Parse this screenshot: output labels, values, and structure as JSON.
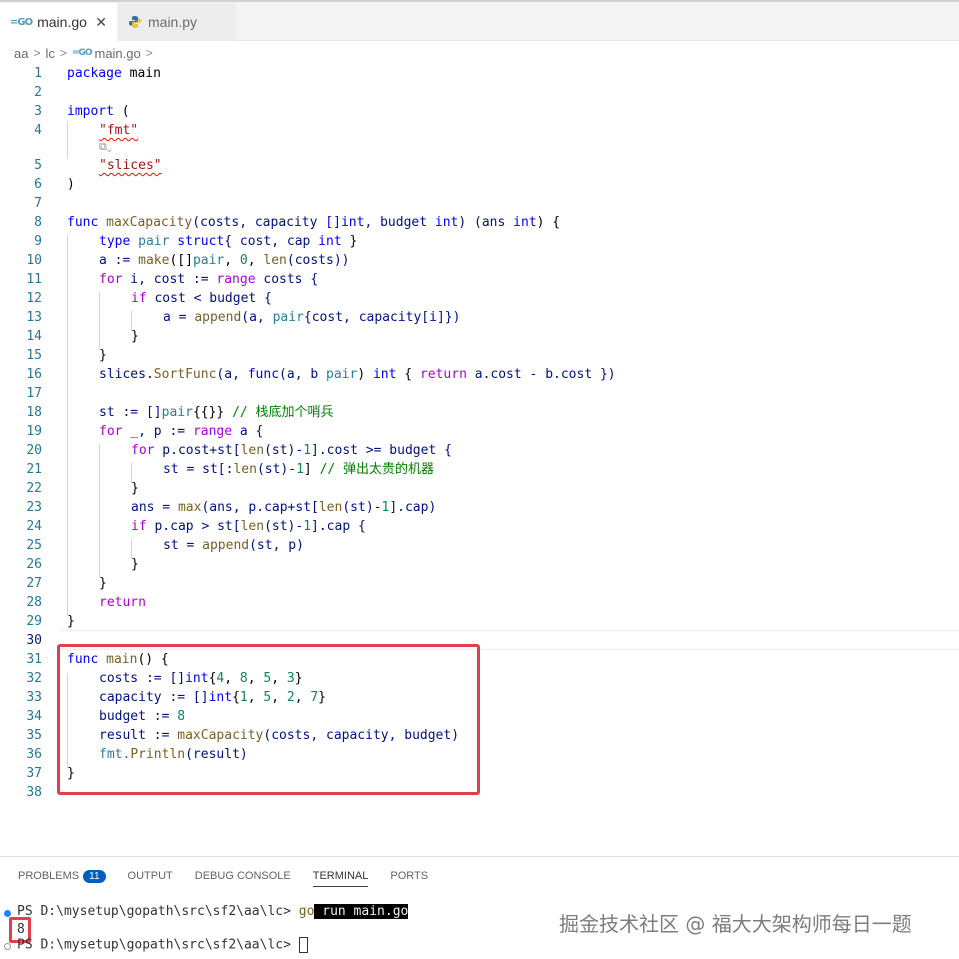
{
  "tabs": [
    {
      "label": "main.go",
      "icon": "go-file-icon",
      "active": true
    },
    {
      "label": "main.py",
      "icon": "python-file-icon",
      "active": false
    }
  ],
  "breadcrumb": [
    "aa",
    "lc",
    "main.go",
    ""
  ],
  "code_lines": [
    {
      "n": "1"
    },
    {
      "n": "2"
    },
    {
      "n": "3"
    },
    {
      "n": "4"
    },
    {
      "n": "5"
    },
    {
      "n": "6"
    },
    {
      "n": "7"
    },
    {
      "n": "8"
    },
    {
      "n": "9"
    },
    {
      "n": "10"
    },
    {
      "n": "11"
    },
    {
      "n": "12"
    },
    {
      "n": "13"
    },
    {
      "n": "14"
    },
    {
      "n": "15"
    },
    {
      "n": "16"
    },
    {
      "n": "17"
    },
    {
      "n": "18"
    },
    {
      "n": "19"
    },
    {
      "n": "20"
    },
    {
      "n": "21"
    },
    {
      "n": "22"
    },
    {
      "n": "23"
    },
    {
      "n": "24"
    },
    {
      "n": "25"
    },
    {
      "n": "26"
    },
    {
      "n": "27"
    },
    {
      "n": "28"
    },
    {
      "n": "29"
    },
    {
      "n": "30"
    },
    {
      "n": "31"
    },
    {
      "n": "32"
    },
    {
      "n": "33"
    },
    {
      "n": "34"
    },
    {
      "n": "35"
    },
    {
      "n": "36"
    },
    {
      "n": "37"
    },
    {
      "n": "38"
    }
  ],
  "code": {
    "l1": [
      "package",
      " main"
    ],
    "l3": [
      "import",
      " ("
    ],
    "l4": "\"fmt\"",
    "l5": "\"slices\"",
    "l6": ")",
    "l8": [
      "func",
      " maxCapacity",
      "(costs, capacity ",
      "[]int",
      ", budget ",
      "int",
      ") (ans ",
      "int",
      ") {"
    ],
    "l9": [
      "type",
      " pair ",
      "struct",
      "{ cost, cap ",
      "int",
      " }"
    ],
    "l10": [
      "a := ",
      "make",
      "([]",
      "pair",
      ", ",
      "0",
      ", ",
      "len",
      "(costs))"
    ],
    "l11": [
      "for",
      " i, cost := ",
      "range",
      " costs {"
    ],
    "l12": [
      "if",
      " cost < budget {"
    ],
    "l13": [
      "a = ",
      "append",
      "(a, ",
      "pair",
      "{cost, capacity[i]})"
    ],
    "l14": "}",
    "l15": "}",
    "l16": [
      "slices.",
      "SortFunc",
      "(a, ",
      "func",
      "(a, b ",
      "pair",
      ") ",
      "int",
      " { ",
      "return",
      " a.cost - b.cost })"
    ],
    "l18": [
      "st := []",
      "pair",
      "{{}} ",
      "// 栈底加个哨兵"
    ],
    "l19": [
      "for",
      " _, p := ",
      "range",
      " a {"
    ],
    "l20": [
      "for",
      " p.cost+st[",
      "len",
      "(st)-",
      "1",
      "].cost >= budget {"
    ],
    "l21": [
      "st = st[:",
      "len",
      "(st)-",
      "1",
      "] ",
      "// 弹出太贵的机器"
    ],
    "l22": "}",
    "l23": [
      "ans = ",
      "max",
      "(ans, p.cap+st[",
      "len",
      "(st)-",
      "1",
      "].cap)"
    ],
    "l24": [
      "if",
      " p.cap > st[",
      "len",
      "(st)-",
      "1",
      "].cap {"
    ],
    "l25": [
      "st = ",
      "append",
      "(st, p)"
    ],
    "l26": "}",
    "l27": "}",
    "l28": "return",
    "l29": "}",
    "l31": [
      "func",
      " main",
      "() {"
    ],
    "l32": [
      "costs := []",
      "int",
      "{",
      "4",
      ", ",
      "8",
      ", ",
      "5",
      ", ",
      "3",
      "}"
    ],
    "l33": [
      "capacity := []",
      "int",
      "{",
      "1",
      ", ",
      "5",
      ", ",
      "2",
      ", ",
      "7",
      "}"
    ],
    "l34": [
      "budget := ",
      "8"
    ],
    "l35": [
      "result := ",
      "maxCapacity",
      "(costs, capacity, budget)"
    ],
    "l36": [
      "fmt.",
      "Println",
      "(result)"
    ],
    "l37": "}"
  },
  "panel": {
    "tabs": [
      {
        "label": "PROBLEMS",
        "badge": "11"
      },
      {
        "label": "OUTPUT"
      },
      {
        "label": "DEBUG CONSOLE"
      },
      {
        "label": "TERMINAL",
        "active": true
      },
      {
        "label": "PORTS"
      }
    ],
    "terminal": {
      "prompt1": "PS D:\\mysetup\\gopath\\src\\sf2\\aa\\lc> ",
      "cmd_go": "go",
      "cmd_rest": " run main.go",
      "output": "8",
      "prompt2": "PS D:\\mysetup\\gopath\\src\\sf2\\aa\\lc> "
    }
  },
  "watermark": "掘金技术社区 @ 福大大架构师每日一题",
  "colors": {
    "keyword": "#0000ff",
    "control": "#af00db",
    "function": "#795e26",
    "type": "#267f99",
    "string": "#a31515",
    "number": "#098658",
    "comment": "#008000",
    "highlight_box": "#e0404a",
    "badge": "#005fb8"
  }
}
